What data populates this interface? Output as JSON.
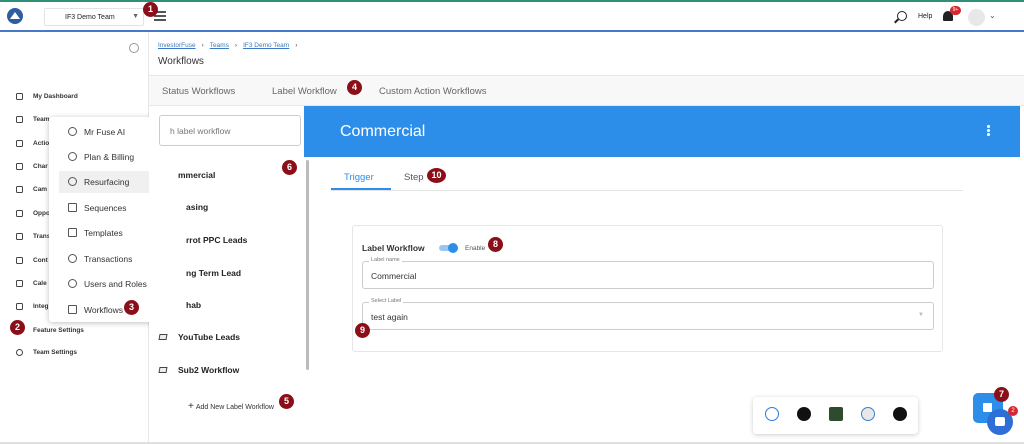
{
  "header": {
    "team_selector": "IF3 Demo Team",
    "help_label": "Help",
    "notification_count": "9+"
  },
  "sidebar": {
    "items": [
      {
        "label": "My Dashboard",
        "icon": "grid-icon"
      },
      {
        "label": "Team",
        "icon": "layers-icon"
      },
      {
        "label": "Actio",
        "icon": "check-circle-icon"
      },
      {
        "label": "Char",
        "icon": "puzzle-icon"
      },
      {
        "label": "Cam",
        "icon": "megaphone-icon"
      },
      {
        "label": "Oppo",
        "icon": "home-icon"
      },
      {
        "label": "Trans",
        "icon": "cash-icon"
      },
      {
        "label": "Cont",
        "icon": "people-icon"
      },
      {
        "label": "Cale",
        "icon": "calendar-icon"
      },
      {
        "label": "Integ",
        "icon": "nodes-icon"
      },
      {
        "label": "Feature Settings",
        "icon": "gear-icon"
      },
      {
        "label": "Team Settings",
        "icon": "gear-icon"
      }
    ]
  },
  "popup_menu": {
    "items": [
      {
        "label": "Mr Fuse AI",
        "icon": "ai-icon"
      },
      {
        "label": "Plan & Billing",
        "icon": "dollar-icon"
      },
      {
        "label": "Resurfacing",
        "icon": "refresh-icon",
        "active": true
      },
      {
        "label": "Sequences",
        "icon": "list-check-icon"
      },
      {
        "label": "Templates",
        "icon": "copy-icon"
      },
      {
        "label": "Transactions",
        "icon": "sync-icon"
      },
      {
        "label": "Users and Roles",
        "icon": "users-icon"
      },
      {
        "label": "Workflows",
        "icon": "sliders-icon"
      }
    ]
  },
  "breadcrumb": {
    "items": [
      "InvestorFuse",
      "Teams",
      "IF3 Demo Team"
    ],
    "separator": "›"
  },
  "page_title": "Workflows",
  "workflow_tabs": [
    "Status Workflows",
    "Label Workflow",
    "Custom Action Workflows"
  ],
  "workflow_list": {
    "search_placeholder": "h label workflow",
    "items": [
      "mmercial",
      "asing",
      "rrot PPC Leads",
      "ng Term Lead",
      "hab",
      "YouTube Leads",
      "Sub2 Workflow"
    ],
    "add_label": "Add New Label Workflow"
  },
  "detail": {
    "title": "Commercial",
    "tabs": [
      "Trigger",
      "Step"
    ],
    "section_label": "Label Workflow",
    "enable_label": "Enable",
    "label_name_caption": "Label name",
    "label_name_value": "Commercial",
    "select_label_caption": "Select Label",
    "select_label_value": "test again"
  },
  "chat": {
    "badge": "2"
  },
  "markers": [
    "1",
    "2",
    "3",
    "4",
    "5",
    "6",
    "7",
    "8",
    "9",
    "10"
  ],
  "colors": {
    "accent": "#2d8eea",
    "marker": "#8b0f18",
    "top_border": "#4a78c8",
    "badge": "#d8282f"
  }
}
